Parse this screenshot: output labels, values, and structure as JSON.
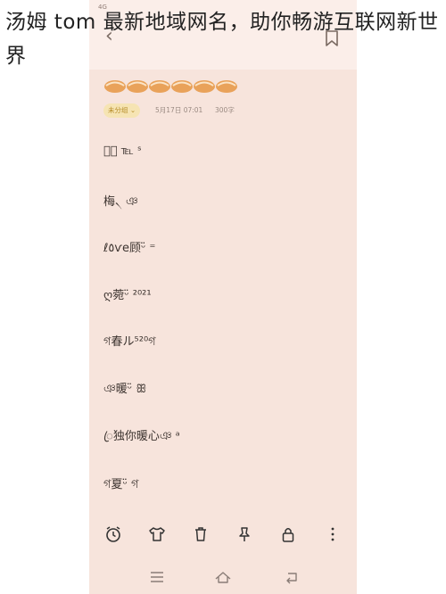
{
  "caption": "汤姆 tom 最新地域网名，助你畅游互联网新世界",
  "status": {
    "network": "4G",
    "right": ""
  },
  "note": {
    "category": "未分组",
    "date": "5月17日 07:01",
    "char_count": "300字",
    "entries": [
      "颜⃢ ℡ ˢ",
      "梅৲ ঞ",
      "ℓ٥ѵe顾ᵕ̈ ⁼",
      "ღ菀ᵕ̈ ²⁰²¹",
      "গ春ル⁵²⁰গ",
      "ঞ暖ᵕ̈ ꕥ",
      "ꦿ独你暖心ঞ ᵃ",
      "গ夏ᵕ̈ গ"
    ]
  },
  "toolbar": {
    "icons": [
      "alarm-icon",
      "shirt-icon",
      "trash-icon",
      "pin-icon",
      "lock-icon",
      "more-icon"
    ]
  },
  "navbar": {
    "icons": [
      "menu-icon",
      "home-icon",
      "back-nav-icon"
    ]
  },
  "colors": {
    "background": "#f7e4dc",
    "accent_chip": "#f6e4b3",
    "decor": "#e9a25a"
  }
}
